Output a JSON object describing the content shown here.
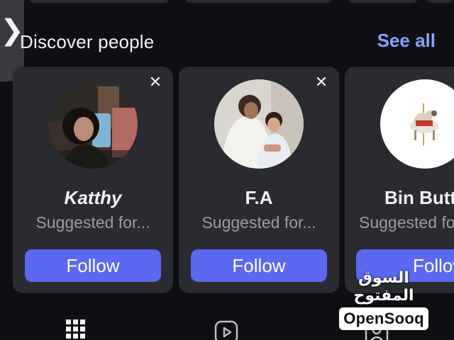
{
  "section": {
    "title": "Discover people",
    "see_all": "See all"
  },
  "side_handle": {
    "glyph": "❯"
  },
  "cards": [
    {
      "name": "Katthy",
      "subtitle": "Suggested for...",
      "follow_label": "Follow",
      "close_glyph": "✕"
    },
    {
      "name": "F.A",
      "subtitle": "Suggested for...",
      "follow_label": "Follow",
      "close_glyph": "✕"
    },
    {
      "name": "Bin Butt",
      "subtitle": "Suggested for",
      "follow_label": "Follow"
    }
  ],
  "tabbar": {
    "icons": [
      "grid-icon",
      "reels-icon",
      "tagged-icon"
    ]
  },
  "watermark": {
    "arabic": "السوق المفتوح",
    "brand": "OpenSooq"
  },
  "colors": {
    "background": "#0e0f12",
    "card": "#2a2b30",
    "accent": "#5b68f0",
    "link": "#8aa2ff",
    "muted": "#9a9ca4"
  }
}
